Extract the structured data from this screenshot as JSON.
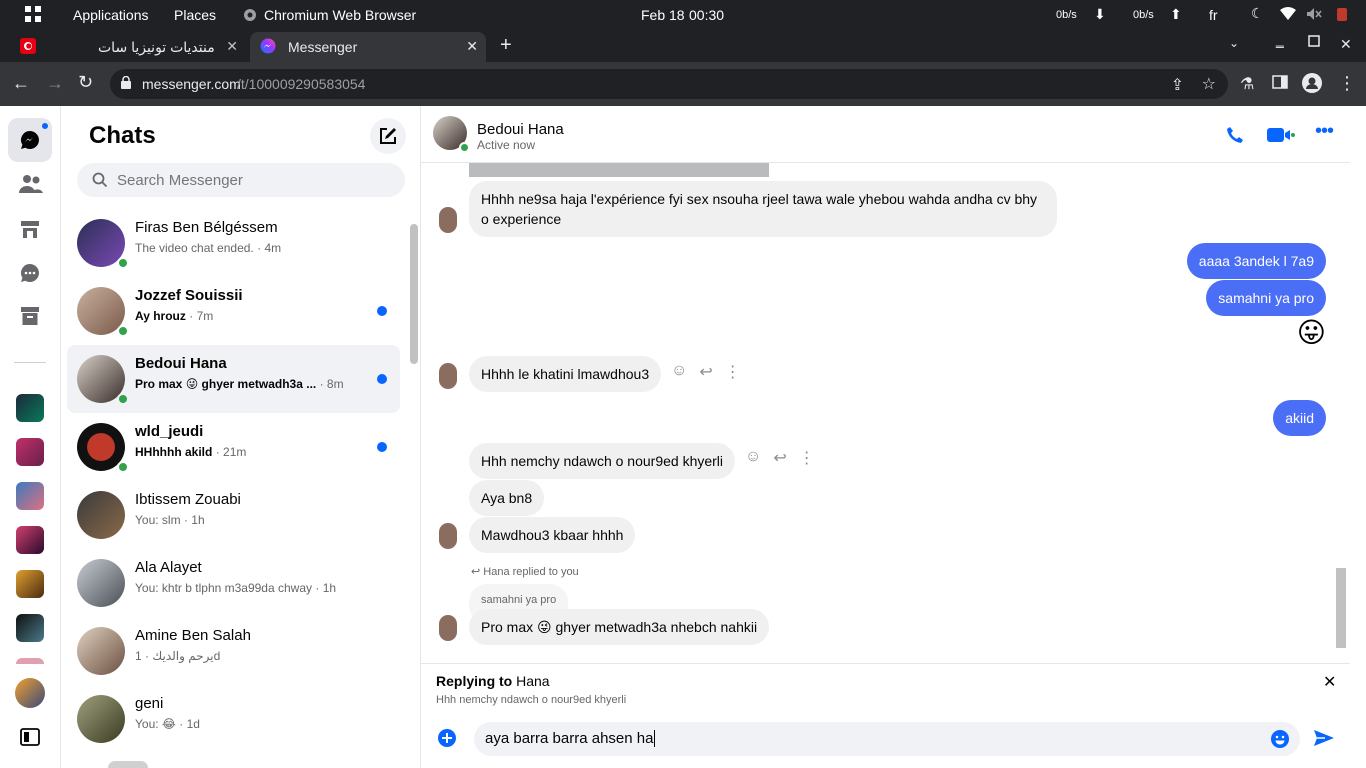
{
  "system_bar": {
    "applications": "Applications",
    "places": "Places",
    "browser_app": "Chromium Web Browser",
    "date": "Feb 18",
    "time": "00:30",
    "net_down": "0b/s",
    "net_up": "0b/s",
    "lang": "fr"
  },
  "tabs": [
    {
      "label": "منتديات تونيزيا سات"
    },
    {
      "label": "Messenger"
    }
  ],
  "address": {
    "url_domain": "messenger.com",
    "url_path": "/t/100009290583054"
  },
  "sidebar": {
    "title": "Chats",
    "search_placeholder": "Search Messenger",
    "chats": [
      {
        "name": "Firas Ben Bélgéssem",
        "preview": "The video chat ended.",
        "time": "· 4m",
        "unread": false,
        "online": true,
        "color": "#2b2f55"
      },
      {
        "name": "Jozzef Souissii",
        "preview": "Ay hrouz",
        "time": "· 7m",
        "unread": true,
        "online": true,
        "color": "#b99787"
      },
      {
        "name": "Bedoui Hana",
        "preview": "Pro max 😜 ghyer metwadh3a ...",
        "time": "· 8m",
        "unread": true,
        "online": true,
        "color": "#3a2d2a"
      },
      {
        "name": "wld_jeudi",
        "preview": "HHhhhh akild",
        "time": "· 21m",
        "unread": true,
        "online": true,
        "color": "#8b1a1a"
      },
      {
        "name": "Ibtissem Zouabi",
        "preview": "You: slm",
        "time": "· 1h",
        "unread": false,
        "online": false,
        "color": "#6b5440"
      },
      {
        "name": "Ala Alayet",
        "preview": "You: khtr b tlphn m3a99da chway",
        "time": "· 1h",
        "unread": false,
        "online": false,
        "color": "#7a7f86"
      },
      {
        "name": "Amine Ben Salah",
        "preview": "يرحم والديك",
        "time": "· 1d",
        "unread": false,
        "online": false,
        "color": "#9c8a77"
      },
      {
        "name": "geni",
        "preview": "You: 😂",
        "time": "· 1d",
        "unread": false,
        "online": false,
        "color": "#5d5a46"
      }
    ]
  },
  "conversation": {
    "name": "Bedoui Hana",
    "status": "Active now",
    "messages": [
      {
        "text": "Hhhh ne9sa haja l'expérience fyi sex nsouha rjeel tawa wale yhebou wahda andha cv bhy",
        "text2": "o  experience"
      },
      {
        "text": "aaaa 3andek l 7a9"
      },
      {
        "text": "samahni ya pro"
      },
      {
        "text": "😛"
      },
      {
        "text": "Hhhh le khatini lmawdhou3"
      },
      {
        "text": "akiid"
      },
      {
        "text": "Hhh nemchy ndawch o nour9ed khyerli"
      },
      {
        "text": "Aya bn8"
      },
      {
        "text": "Mawdhou3 kbaar hhhh"
      },
      {
        "text": "samahni ya pro"
      },
      {
        "text": "Pro max 😜 ghyer metwadh3a nhebch nahkii"
      }
    ],
    "replied_label": "Hana replied to you",
    "reply_bar": {
      "prefix": "Replying to",
      "name": "Hana",
      "quote": "Hhh nemchy ndawch o nour9ed khyerli"
    },
    "composer_value": "aya barra barra ahsen ha"
  }
}
